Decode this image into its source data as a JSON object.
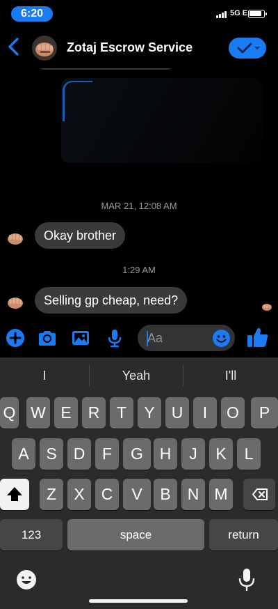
{
  "status_bar": {
    "time": "6:20",
    "network": "5G E"
  },
  "header": {
    "contact_name": "Zotaj Escrow Service"
  },
  "chat": {
    "timestamp_1": "MAR 21, 12:08 AM",
    "message_1": "Okay brother",
    "timestamp_2": "1:29 AM",
    "message_2": "Selling gp cheap, need?"
  },
  "composer": {
    "placeholder": "Aa"
  },
  "keyboard": {
    "suggestions": [
      "I",
      "Yeah",
      "I'll"
    ],
    "row1": [
      "Q",
      "W",
      "E",
      "R",
      "T",
      "Y",
      "U",
      "I",
      "O",
      "P"
    ],
    "row2": [
      "A",
      "S",
      "D",
      "F",
      "G",
      "H",
      "J",
      "K",
      "L"
    ],
    "row3": [
      "Z",
      "X",
      "C",
      "V",
      "B",
      "N",
      "M"
    ],
    "numbers_key": "123",
    "space_key": "space",
    "return_key": "return"
  },
  "colors": {
    "accent": "#1a7cf5",
    "bubble": "#3a3a3c",
    "key": "#6b6b6d",
    "keyboard_bg": "#2b2b2d"
  },
  "icons": [
    "back-chevron-icon",
    "checkmark-dropdown-icon",
    "add-icon",
    "camera-icon",
    "gallery-icon",
    "microphone-icon",
    "emoji-icon",
    "like-thumbs-up-icon",
    "backspace-icon",
    "shift-icon",
    "globe-emoji-icon",
    "dictation-icon"
  ]
}
